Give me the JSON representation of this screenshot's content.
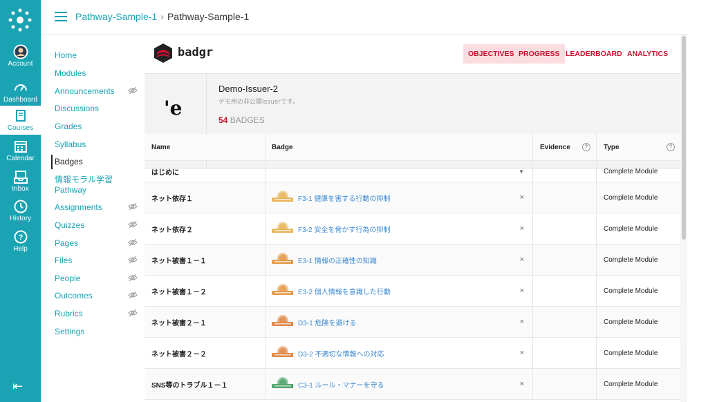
{
  "breadcrumb": {
    "course": "Pathway-Sample-1",
    "current": "Pathway-Sample-1"
  },
  "global_nav": [
    {
      "label": "Account",
      "icon": "account-avatar-icon"
    },
    {
      "label": "Dashboard",
      "icon": "dashboard-icon"
    },
    {
      "label": "Courses",
      "icon": "courses-icon",
      "active": true
    },
    {
      "label": "Calendar",
      "icon": "calendar-icon"
    },
    {
      "label": "Inbox",
      "icon": "inbox-icon"
    },
    {
      "label": "History",
      "icon": "history-icon"
    },
    {
      "label": "Help",
      "icon": "help-icon"
    }
  ],
  "course_nav": [
    {
      "label": "Home"
    },
    {
      "label": "Modules"
    },
    {
      "label": "Announcements",
      "hidden": true
    },
    {
      "label": "Discussions"
    },
    {
      "label": "Grades"
    },
    {
      "label": "Syllabus"
    },
    {
      "label": "Badges",
      "active": true
    },
    {
      "label": "情報モラル学習 Pathway"
    },
    {
      "label": "Assignments",
      "hidden": true
    },
    {
      "label": "Quizzes",
      "hidden": true
    },
    {
      "label": "Pages",
      "hidden": true
    },
    {
      "label": "Files",
      "hidden": true
    },
    {
      "label": "People",
      "hidden": true
    },
    {
      "label": "Outcomes",
      "hidden": true
    },
    {
      "label": "Rubrics",
      "hidden": true
    },
    {
      "label": "Settings"
    }
  ],
  "badgr": {
    "brand": "badgr",
    "tabs": [
      {
        "label": "OBJECTIVES",
        "highlight": true
      },
      {
        "label": "PROGRESS",
        "highlight": true
      },
      {
        "label": "LEADERBOARD",
        "highlight": false
      },
      {
        "label": "ANALYTICS",
        "highlight": false
      }
    ]
  },
  "issuer": {
    "logo_text": "'e",
    "name": "Demo-Issuer-2",
    "description": "デモ用の非公開Issuerです。",
    "badge_count": "54",
    "badge_count_label": "BADGES"
  },
  "table": {
    "headers": {
      "name": "Name",
      "badge": "Badge",
      "evidence": "Evidence",
      "type": "Type"
    },
    "rows": [
      {
        "name": "はじめに",
        "badge": "",
        "type": "Complete Module",
        "badge_color": ""
      },
      {
        "name": "ネット依存１",
        "badge": "F3-1 健康を害する行動の抑制",
        "type": "Complete Module",
        "badge_color": "#e8b55a"
      },
      {
        "name": "ネット依存２",
        "badge": "F3-2 安全を脅かす行為の抑制",
        "type": "Complete Module",
        "badge_color": "#e8b55a"
      },
      {
        "name": "ネット被害１－１",
        "badge": "E3-1 情報の正確性の知識",
        "type": "Complete Module",
        "badge_color": "#e59a4a"
      },
      {
        "name": "ネット被害１－２",
        "badge": "E3-2 個人情報を意識した行動",
        "type": "Complete Module",
        "badge_color": "#e59a4a"
      },
      {
        "name": "ネット被害２－１",
        "badge": "D3-1 危険を避ける",
        "type": "Complete Module",
        "badge_color": "#e0894a"
      },
      {
        "name": "ネット被害２－２",
        "badge": "D3-2 不適切な情報への対応",
        "type": "Complete Module",
        "badge_color": "#e0894a"
      },
      {
        "name": "SNS等のトラブル１－１",
        "badge": "C3-1 ルール・マナーを守る",
        "type": "Complete Module",
        "badge_color": "#4fa36a"
      }
    ]
  }
}
